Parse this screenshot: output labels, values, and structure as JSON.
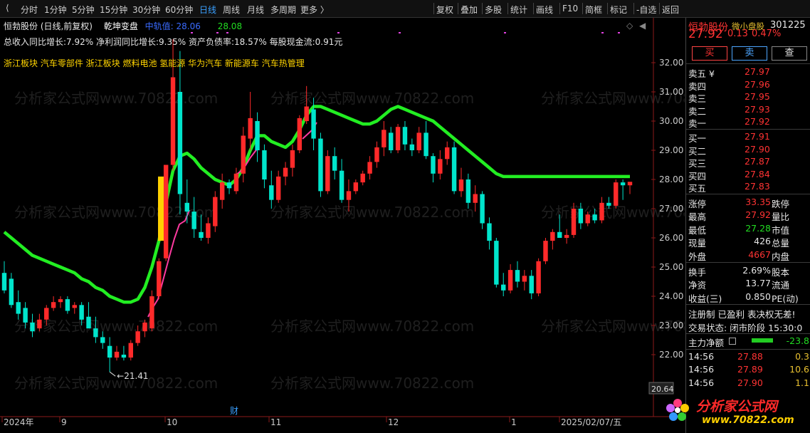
{
  "toolbar": {
    "periods": [
      "分时",
      "1分钟",
      "5分钟",
      "15分钟",
      "30分钟",
      "60分钟",
      "日线",
      "周线",
      "月线",
      "多周期",
      "更多 〉"
    ],
    "active_period": "日线",
    "tools": [
      "复权",
      "叠加",
      "多股",
      "统计",
      "画线",
      "F10",
      "简框",
      "标记",
      "-自选",
      "返回"
    ]
  },
  "chart": {
    "header": {
      "title": "恒勃股份 (日线,前复权)",
      "indicator_name": "乾坤变盘",
      "indicator_label": "中轨值: 28.06",
      "indicator_value": "28.08"
    },
    "fundamentals": "总收入同比增长:7.92%   净利润同比增长:9.35%   资产负债率:18.57%   每股现金流:0.91元",
    "concepts": "浙江板块  汽车零部件  浙江板块  燃料电池  氢能源  华为汽车  新能源车  汽车热管理",
    "price_axis": [
      "32.00",
      "31.00",
      "30.00",
      "29.00",
      "28.00",
      "27.00",
      "26.00",
      "25.00",
      "24.00",
      "23.00",
      "22.00"
    ],
    "low_label": "21.41",
    "current_box": "20.64",
    "date_axis": [
      "2024年",
      "9",
      "10",
      "11",
      "12",
      "1",
      "2025/02/07/五"
    ],
    "event_marker": "财",
    "watermark": "分析家公式网www.70822.com"
  },
  "chart_data": {
    "type": "candlestick",
    "ylim": [
      21.3,
      33.0
    ],
    "candles": [
      [
        24.8,
        25.2,
        24.1,
        24.2
      ],
      [
        24.6,
        24.8,
        23.6,
        23.7
      ],
      [
        23.8,
        24.2,
        23.2,
        23.4
      ],
      [
        23.6,
        23.8,
        22.9,
        23.1
      ],
      [
        23.1,
        23.4,
        22.6,
        22.8
      ],
      [
        22.9,
        23.4,
        22.8,
        23.2
      ],
      [
        23.2,
        23.7,
        23.0,
        23.6
      ],
      [
        23.6,
        24.0,
        23.5,
        23.8
      ],
      [
        23.8,
        24.0,
        23.6,
        23.9
      ],
      [
        23.9,
        24.0,
        23.4,
        23.5
      ],
      [
        23.6,
        23.8,
        23.4,
        23.7
      ],
      [
        23.7,
        23.8,
        23.0,
        23.2
      ],
      [
        23.3,
        23.8,
        22.9,
        22.9
      ],
      [
        22.9,
        23.3,
        22.4,
        22.6
      ],
      [
        22.6,
        22.8,
        22.2,
        22.4
      ],
      [
        22.3,
        22.6,
        21.41,
        21.9
      ],
      [
        21.9,
        22.3,
        21.8,
        22.1
      ],
      [
        22.0,
        22.3,
        21.8,
        21.9
      ],
      [
        21.9,
        22.5,
        21.8,
        22.4
      ],
      [
        22.4,
        23.0,
        22.3,
        22.8
      ],
      [
        22.8,
        23.2,
        22.6,
        23.1
      ],
      [
        22.9,
        24.2,
        22.8,
        24.0
      ],
      [
        24.0,
        25.3,
        23.9,
        25.2
      ],
      [
        25.3,
        28.5,
        25.2,
        28.5
      ],
      [
        28.5,
        32.8,
        28.3,
        31.5
      ],
      [
        31.0,
        32.4,
        26.8,
        27.5
      ],
      [
        27.2,
        28.0,
        26.5,
        26.9
      ],
      [
        26.9,
        27.4,
        26.0,
        26.3
      ],
      [
        26.2,
        26.8,
        25.9,
        26.0
      ],
      [
        26.0,
        26.7,
        25.8,
        26.5
      ],
      [
        26.4,
        27.6,
        26.2,
        27.4
      ],
      [
        27.3,
        28.2,
        27.0,
        27.9
      ],
      [
        27.9,
        28.0,
        27.5,
        27.7
      ],
      [
        27.6,
        28.4,
        27.5,
        28.2
      ],
      [
        28.2,
        29.8,
        27.9,
        29.5
      ],
      [
        29.4,
        31.0,
        29.0,
        30.1
      ],
      [
        30.0,
        30.3,
        28.6,
        29.0
      ],
      [
        29.0,
        29.2,
        27.7,
        28.0
      ],
      [
        27.8,
        28.3,
        27.0,
        27.3
      ],
      [
        27.3,
        28.3,
        27.2,
        28.1
      ],
      [
        28.1,
        28.6,
        27.8,
        28.4
      ],
      [
        28.4,
        29.2,
        28.1,
        29.0
      ],
      [
        29.0,
        30.2,
        28.9,
        30.1
      ],
      [
        30.0,
        31.2,
        29.9,
        30.5
      ],
      [
        30.4,
        30.8,
        29.0,
        29.4
      ],
      [
        29.4,
        29.6,
        27.4,
        27.6
      ],
      [
        27.6,
        29.0,
        27.5,
        28.8
      ],
      [
        28.8,
        29.1,
        28.0,
        28.3
      ],
      [
        28.3,
        28.7,
        27.2,
        27.3
      ],
      [
        27.3,
        28.0,
        26.9,
        27.6
      ],
      [
        27.6,
        28.0,
        27.5,
        27.9
      ],
      [
        27.9,
        28.3,
        27.8,
        28.2
      ],
      [
        28.2,
        28.8,
        28.0,
        28.6
      ],
      [
        28.6,
        29.3,
        28.4,
        29.1
      ],
      [
        29.1,
        30.0,
        28.8,
        29.7
      ],
      [
        29.6,
        29.8,
        28.9,
        29.0
      ],
      [
        29.0,
        29.9,
        28.9,
        29.8
      ],
      [
        29.8,
        30.0,
        29.0,
        29.2
      ],
      [
        29.2,
        29.4,
        28.8,
        29.0
      ],
      [
        29.0,
        29.8,
        28.9,
        29.6
      ],
      [
        29.6,
        30.0,
        28.7,
        28.8
      ],
      [
        28.8,
        28.9,
        27.9,
        28.2
      ],
      [
        28.2,
        29.0,
        28.0,
        28.7
      ],
      [
        28.7,
        29.3,
        28.5,
        29.1
      ],
      [
        29.1,
        29.3,
        27.5,
        27.6
      ],
      [
        27.6,
        28.4,
        27.4,
        28.0
      ],
      [
        28.0,
        28.2,
        27.0,
        27.2
      ],
      [
        27.2,
        27.8,
        26.9,
        27.5
      ],
      [
        27.5,
        27.6,
        26.3,
        26.5
      ],
      [
        26.5,
        26.7,
        25.6,
        25.9
      ],
      [
        25.9,
        26.0,
        24.3,
        24.4
      ],
      [
        24.4,
        24.8,
        24.0,
        24.2
      ],
      [
        24.2,
        25.1,
        24.1,
        24.9
      ],
      [
        24.9,
        25.2,
        24.3,
        24.5
      ],
      [
        24.5,
        24.9,
        24.2,
        24.7
      ],
      [
        24.7,
        24.9,
        23.9,
        24.1
      ],
      [
        24.1,
        25.3,
        24.0,
        25.2
      ],
      [
        25.2,
        26.0,
        25.1,
        25.9
      ],
      [
        25.9,
        26.3,
        25.6,
        26.2
      ],
      [
        26.2,
        26.8,
        26.0,
        26.0
      ],
      [
        26.0,
        26.3,
        25.8,
        26.1
      ],
      [
        26.1,
        27.2,
        26.0,
        27.0
      ],
      [
        27.0,
        27.2,
        26.3,
        26.5
      ],
      [
        26.5,
        26.9,
        26.4,
        26.8
      ],
      [
        26.8,
        27.0,
        26.5,
        26.6
      ],
      [
        26.6,
        27.4,
        26.5,
        27.2
      ],
      [
        27.2,
        27.4,
        27.0,
        27.1
      ],
      [
        27.1,
        28.0,
        27.0,
        27.9
      ],
      [
        27.9,
        28.0,
        27.3,
        27.8
      ],
      [
        27.8,
        27.9,
        27.5,
        27.92
      ]
    ],
    "midline": [
      26.2,
      26.0,
      25.8,
      25.6,
      25.4,
      25.3,
      25.2,
      25.1,
      25.0,
      24.9,
      24.8,
      24.6,
      24.5,
      24.3,
      24.2,
      24.0,
      23.9,
      23.8,
      23.8,
      23.9,
      24.3,
      25.0,
      25.9,
      27.2,
      28.3,
      28.8,
      28.9,
      28.7,
      28.4,
      28.2,
      28.0,
      27.9,
      27.8,
      28.0,
      28.4,
      29.0,
      29.5,
      29.5,
      29.3,
      29.2,
      29.1,
      29.3,
      29.7,
      30.2,
      30.5,
      30.5,
      30.4,
      30.3,
      30.2,
      30.1,
      30.0,
      29.9,
      29.9,
      30.0,
      30.2,
      30.4,
      30.5,
      30.4,
      30.3,
      30.2,
      30.1,
      30.0,
      29.8,
      29.6,
      29.4,
      29.2,
      29.0,
      28.8,
      28.6,
      28.4,
      28.2,
      28.1,
      28.1,
      28.1,
      28.1,
      28.1,
      28.1,
      28.1,
      28.1,
      28.1,
      28.1,
      28.1,
      28.1,
      28.1,
      28.1,
      28.1,
      28.1,
      28.1,
      28.1,
      28.1
    ]
  },
  "panel": {
    "stock_name": "恒勃股份",
    "stock_tag": "微小盘股",
    "stock_code": "301225",
    "price": "27.92",
    "change": "0.13",
    "change_pct": "0.47%",
    "buttons": [
      "买",
      "卖",
      "查"
    ],
    "asks": [
      {
        "label": "卖五 ¥",
        "price": "27.97"
      },
      {
        "label": "卖四",
        "price": "27.96"
      },
      {
        "label": "卖三",
        "price": "27.95"
      },
      {
        "label": "卖二",
        "price": "27.93"
      },
      {
        "label": "卖一",
        "price": "27.92"
      }
    ],
    "bids": [
      {
        "label": "买一",
        "price": "27.91"
      },
      {
        "label": "买二",
        "price": "27.90"
      },
      {
        "label": "买三",
        "price": "27.87"
      },
      {
        "label": "买四",
        "price": "27.84"
      },
      {
        "label": "买五",
        "price": "27.83"
      }
    ],
    "stats": [
      {
        "k1": "涨停",
        "v1": "33.35",
        "k2": "跌停"
      },
      {
        "k1": "最高",
        "v1": "27.92",
        "k2": "量比"
      },
      {
        "k1": "最低",
        "v1": "27.28",
        "k2": "市值"
      },
      {
        "k1": "现量",
        "v1": "426",
        "k2": "总量"
      },
      {
        "k1": "外盘",
        "v1": "4667",
        "k2": "内盘"
      }
    ],
    "stats2": [
      {
        "k1": "换手",
        "v1": "2.69%",
        "k2": "股本"
      },
      {
        "k1": "净资",
        "v1": "13.77",
        "k2": "流通"
      },
      {
        "k1": "收益(三)",
        "v1": "0.850",
        "k2": "PE(动)"
      }
    ],
    "notice": "注册制 已盈利 表决权无差!",
    "trade_status": "交易状态: 闭市阶段 15:30:0",
    "net_label": "主力净额",
    "net_value": "-23.8",
    "ticks": [
      {
        "time": "14:56",
        "price": "27.88",
        "vol": "0.3"
      },
      {
        "time": "14:56",
        "price": "27.89",
        "vol": "10.6"
      },
      {
        "time": "14:56",
        "price": "27.90",
        "vol": "1.1"
      }
    ],
    "logo_text": "分析家公式网",
    "logo_url": "www.70822.com"
  }
}
